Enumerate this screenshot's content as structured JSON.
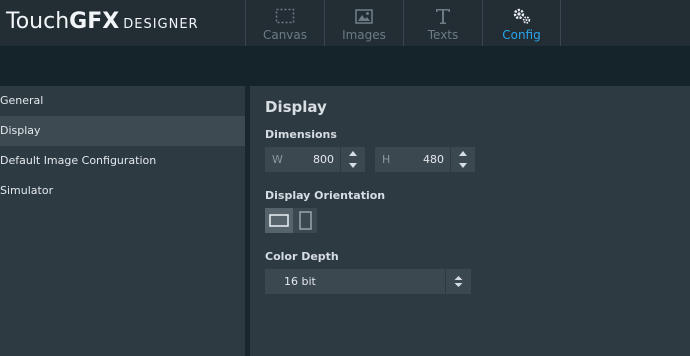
{
  "app": {
    "logo_part1": "Touch",
    "logo_part2": "GFX",
    "logo_part3": "DESIGNER"
  },
  "tabs": [
    {
      "label": "Canvas",
      "icon": "canvas-icon"
    },
    {
      "label": "Images",
      "icon": "images-icon"
    },
    {
      "label": "Texts",
      "icon": "texts-icon"
    },
    {
      "label": "Config",
      "icon": "config-icon"
    }
  ],
  "active_tab": "Config",
  "sidebar": {
    "items": [
      {
        "label": "General"
      },
      {
        "label": "Display"
      },
      {
        "label": "Default Image Configuration"
      },
      {
        "label": "Simulator"
      }
    ],
    "selected": "Display"
  },
  "main": {
    "title": "Display",
    "dimensions": {
      "label": "Dimensions",
      "width_prefix": "W",
      "width_value": "800",
      "height_prefix": "H",
      "height_value": "480"
    },
    "orientation": {
      "label": "Display Orientation",
      "selected": "landscape"
    },
    "color_depth": {
      "label": "Color Depth",
      "value": "16 bit"
    }
  },
  "colors": {
    "accent": "#2ba4ea",
    "header_bg": "#222d34",
    "subbar_bg": "#15232b",
    "panel_bg": "#2d3a42",
    "control_bg": "#3c4850"
  }
}
